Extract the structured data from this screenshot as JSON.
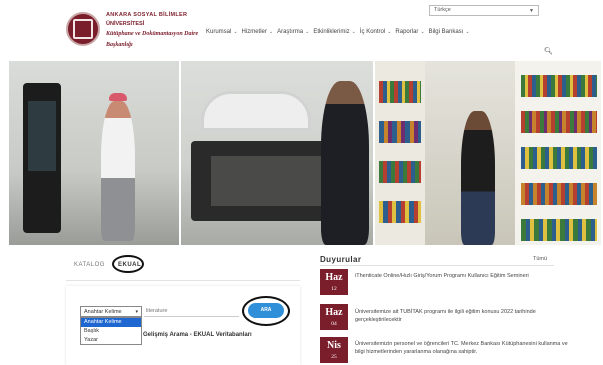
{
  "header": {
    "university_line1": "ANKARA SOSYAL BİLİMLER",
    "university_line2": "ÜNİVERSİTESİ",
    "department_line1": "Kütüphane ve Dokümantasyon Daire",
    "department_line2": "Başkanlığı",
    "language": "Türkçe",
    "nav": [
      {
        "label": "Kurumsal"
      },
      {
        "label": "Hizmetler"
      },
      {
        "label": "Araştırma"
      },
      {
        "label": "Etkinliklerimiz"
      },
      {
        "label": "İç Kontrol"
      },
      {
        "label": "Raporlar"
      },
      {
        "label": "Bilgi Bankası"
      }
    ]
  },
  "catalog": {
    "tabs": [
      {
        "label": "KATALOG"
      },
      {
        "label": "EKUAL"
      }
    ],
    "search_type": "Anahtar Kelime",
    "search_type_options": [
      "Anahtar Kelime",
      "Başlık",
      "Yazar"
    ],
    "query_value": "literature",
    "search_button": "ARA",
    "advanced_link": "Gelişmiş Arama - EKUAL Veritabanları"
  },
  "announcements": {
    "title": "Duyurular",
    "view_all": "Tümü",
    "items": [
      {
        "month": "Haz",
        "day": "12",
        "text": "iThenticate Online/Hızlı Giriş/Yorum Programı Kullanıcı Eğitim Semineri"
      },
      {
        "month": "Haz",
        "day": "04",
        "text": "Üniversitemize ait TUBİTAK programı ile ilgili eğitim konusu 2022 tarihinde gerçekleştirilecektir"
      },
      {
        "month": "Nis",
        "day": "25",
        "text": "Üniversitemizin personel ve öğrencileri TC. Merkez Bankası Kütüphanesini kullanma ve bilgi hizmetlerinden yararlanma olanağına sahiptir."
      }
    ]
  },
  "colors": {
    "brand": "#7b1e2b",
    "button": "#2f8fd8",
    "dropdown_active": "#1e66d0"
  }
}
